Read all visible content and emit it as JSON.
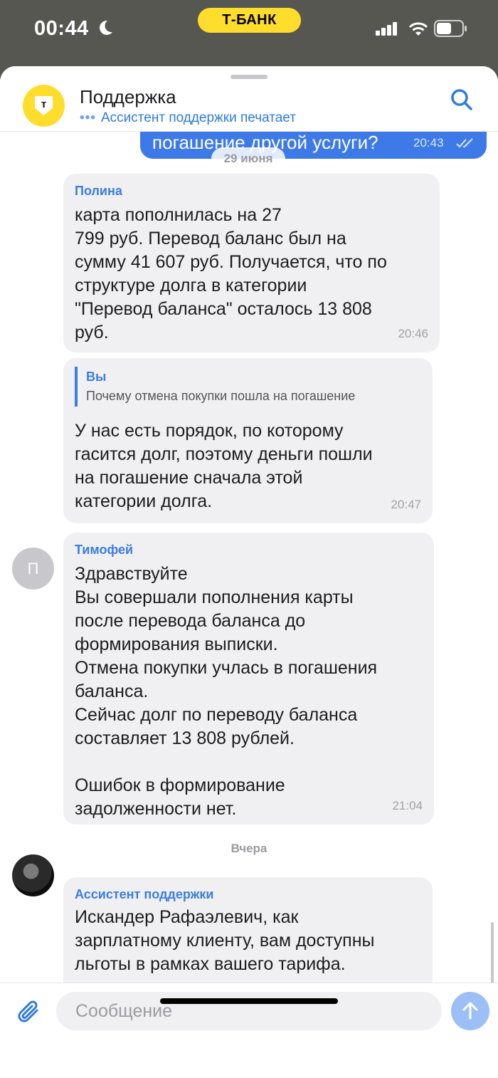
{
  "status_bar": {
    "time": "00:44",
    "bank": "Т-БАНК"
  },
  "header": {
    "title": "Поддержка",
    "subtitle": "Ассистент поддержки печатает",
    "logo_letter": "т"
  },
  "outgoing": {
    "text": "погашение другой услуги?",
    "time": "20:43"
  },
  "date_separators": {
    "first": "29 июня",
    "second": "Вчера"
  },
  "messages": [
    {
      "sender": "Полина",
      "text": "                       карта пополнилась на 27\n799 руб. Перевод баланс был на\nсумму 41 607 руб. Получается, что по\nструктуре долга в категории\n\"Перевод баланса\" осталось 13 808\nруб.",
      "time": "20:46"
    },
    {
      "reply_to": "Вы",
      "reply_text": "Почему отмена покупки пошла на погашение",
      "text": "У нас есть порядок, по которому\nгасится долг, поэтому деньги пошли\nна погашение сначала этой\nкатегории долга.",
      "time": "20:47",
      "avatar_letter": "П"
    },
    {
      "sender": "Тимофей",
      "text": "Здравствуйте\nВы совершали пополнения карты\nпосле перевода баланса до\nформирования выписки.\nОтмена покупки учлась в погашения\nбаланса.\nСейчас долг по переводу баланса\nсоставляет 13 808 рублей.\n\nОшибок в формирование\nзадолженности нет.",
      "time": "21:04"
    },
    {
      "sender": "Ассистент поддержки",
      "text": "Искандер Рафаэлевич, как\nзарплатному клиенту, вам доступны\nльготы в рамках вашего тарифа."
    }
  ],
  "composer": {
    "placeholder": "Сообщение"
  },
  "colors": {
    "accent": "#3b7ddd",
    "brand": "#ffdd2d",
    "outgoing_bubble": "#3d7ae8",
    "incoming_bubble": "#f0f0f3"
  },
  "icons": [
    "moon-icon",
    "signal-icon",
    "wifi-icon",
    "battery-icon",
    "search-icon",
    "double-check-icon",
    "chevron-down-icon",
    "paperclip-icon",
    "send-arrow-icon",
    "plus-icon"
  ]
}
